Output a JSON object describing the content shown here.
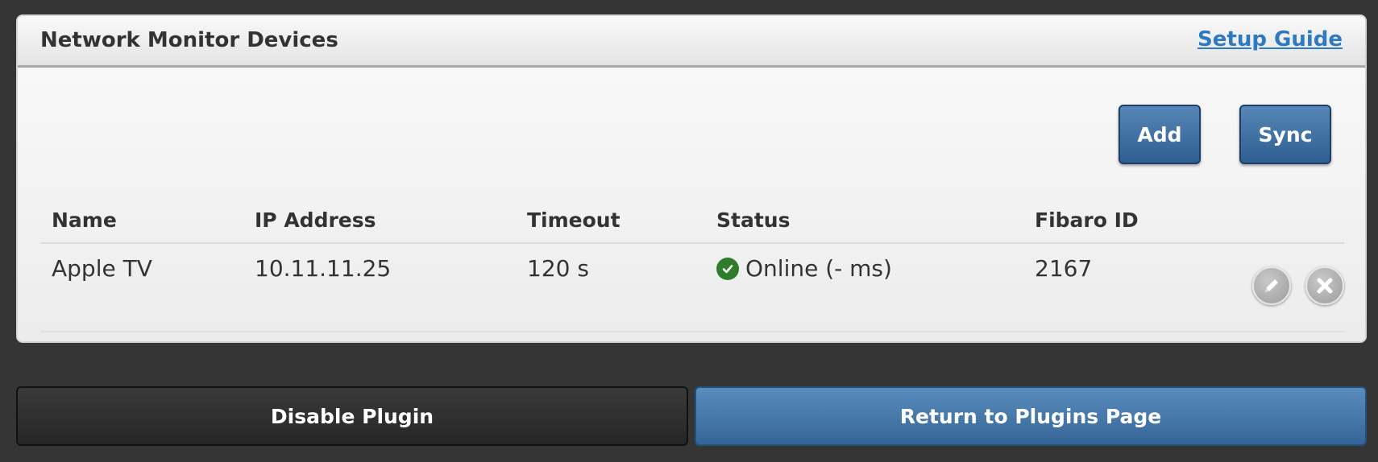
{
  "panel": {
    "title": "Network Monitor Devices",
    "setup_guide_label": "Setup Guide"
  },
  "toolbar": {
    "add_label": "Add",
    "sync_label": "Sync"
  },
  "table": {
    "columns": [
      "Name",
      "IP Address",
      "Timeout",
      "Status",
      "Fibaro ID"
    ],
    "rows": [
      {
        "name": "Apple TV",
        "ip": "10.11.11.25",
        "timeout": "120 s",
        "status": "Online (- ms)",
        "status_icon": "check-circle-icon",
        "status_color": "#2f7d2c",
        "fibaro_id": "2167",
        "actions": [
          "edit-icon",
          "close-icon"
        ]
      }
    ]
  },
  "footer": {
    "disable_label": "Disable Plugin",
    "return_label": "Return to Plugins Page"
  },
  "colors": {
    "accent_blue": "#3a6a9c",
    "link_blue": "#2d7ac0",
    "background": "#353535"
  }
}
